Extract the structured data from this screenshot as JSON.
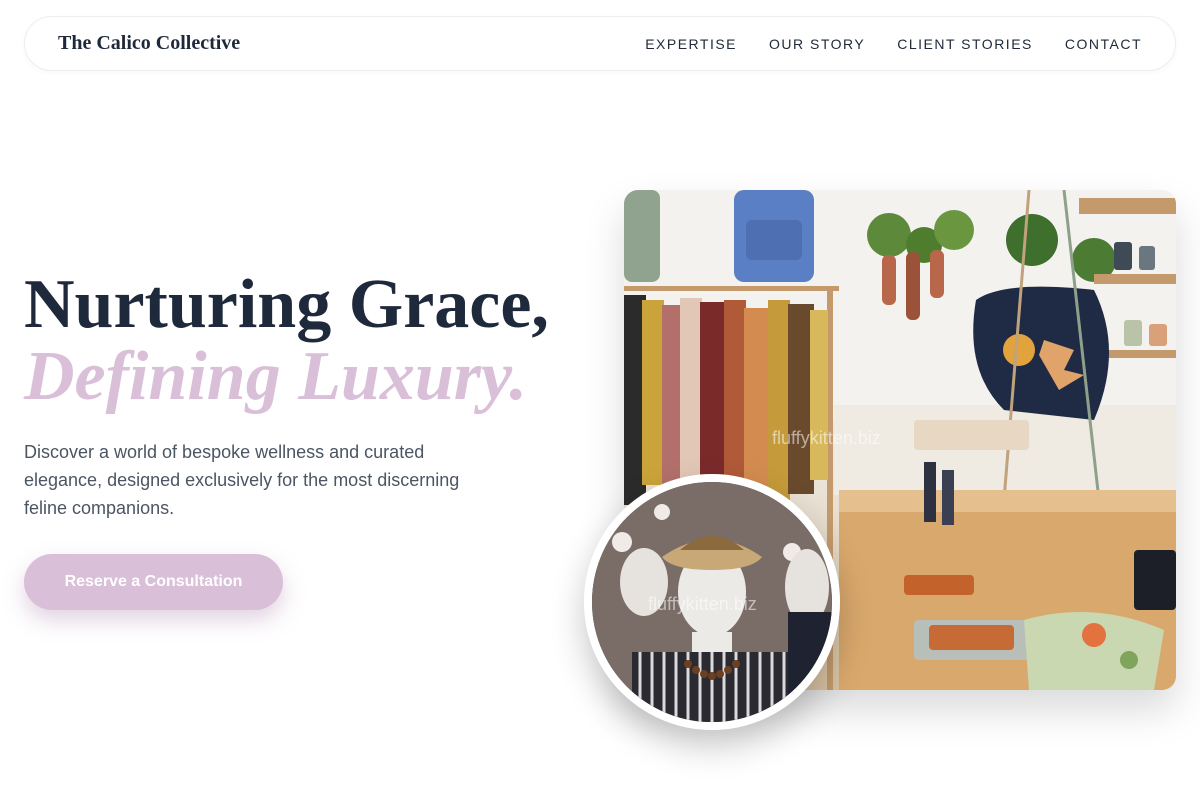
{
  "brand": "The Calico Collective",
  "nav": {
    "items": [
      "EXPERTISE",
      "OUR STORY",
      "CLIENT STORIES",
      "CONTACT"
    ]
  },
  "hero": {
    "title_line1": "Nurturing Grace,",
    "title_line2": "Defining Luxury.",
    "description": "Discover a world of bespoke wellness and curated elegance, designed exclusively for the most discerning feline companions.",
    "cta_label": "Reserve a Consultation"
  },
  "images": {
    "main_watermark": "fluffykitten.biz",
    "inset_watermark": "fluffykitten.biz"
  },
  "colors": {
    "accent": "#d9bfd8",
    "heading": "#1e293b",
    "body_text": "#4b5563"
  }
}
